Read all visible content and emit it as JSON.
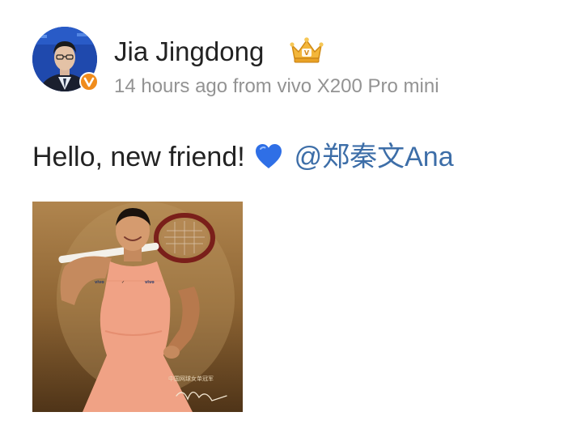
{
  "post": {
    "author": "Jia Jingdong",
    "meta": "14 hours ago from vivo X200 Pro mini",
    "text_prefix": "Hello, new friend!",
    "heart_icon": "blue-heart-icon",
    "mention": "@郑秦文Ana",
    "photo_caption": "中国网球女单冠军"
  },
  "icons": {
    "avatar": "avatar-image",
    "badge": "verified-badge-icon",
    "crown": "crown-badge-icon"
  },
  "colors": {
    "text": "#222222",
    "meta": "#939393",
    "mention": "#3d6ea8",
    "heart": "#2f6fe6",
    "badge": "#f08c1c"
  }
}
